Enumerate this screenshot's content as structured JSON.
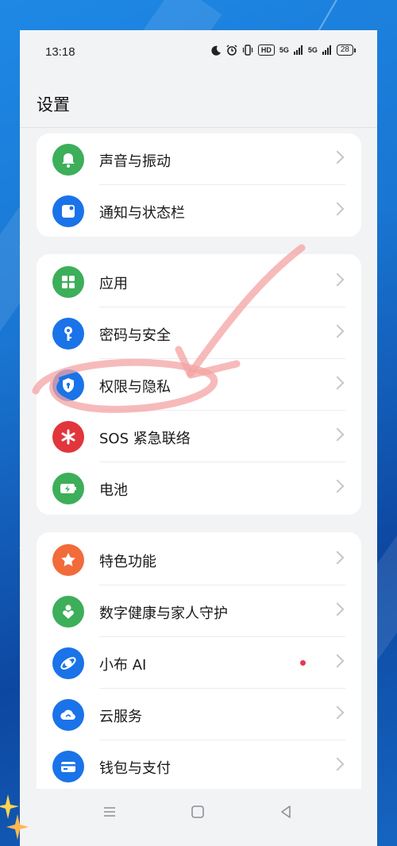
{
  "status_bar": {
    "time": "13:18",
    "hd_label": "HD",
    "net_label_1": "5G",
    "net_label_2": "5G",
    "battery_level": "28"
  },
  "page_title": "设置",
  "groups": [
    {
      "items": [
        {
          "label": "声音与振动",
          "icon": "bell-icon",
          "color": "#3dae5a"
        },
        {
          "label": "通知与状态栏",
          "icon": "notification-icon",
          "color": "#1a73e8"
        }
      ]
    },
    {
      "items": [
        {
          "label": "应用",
          "icon": "apps-grid-icon",
          "color": "#3dae5a"
        },
        {
          "label": "密码与安全",
          "icon": "key-icon",
          "color": "#1a73e8"
        },
        {
          "label": "权限与隐私",
          "icon": "shield-icon",
          "color": "#1a73e8"
        },
        {
          "label": "SOS 紧急联络",
          "icon": "asterisk-icon",
          "color": "#e0363c"
        },
        {
          "label": "电池",
          "icon": "battery-icon",
          "color": "#3dae5a"
        }
      ]
    },
    {
      "items": [
        {
          "label": "特色功能",
          "icon": "star-icon",
          "color": "#f26b3a"
        },
        {
          "label": "数字健康与家人守护",
          "icon": "heart-person-icon",
          "color": "#3dae5a"
        },
        {
          "label": "小布 AI",
          "icon": "ai-assistant-icon",
          "color": "#1a73e8",
          "has_dot": true
        },
        {
          "label": "云服务",
          "icon": "cloud-icon",
          "color": "#1a73e8"
        },
        {
          "label": "钱包与支付",
          "icon": "wallet-icon",
          "color": "#1a73e8"
        }
      ]
    }
  ],
  "navigation": {
    "menu": "menu-icon",
    "home": "home-icon",
    "back": "back-icon"
  }
}
